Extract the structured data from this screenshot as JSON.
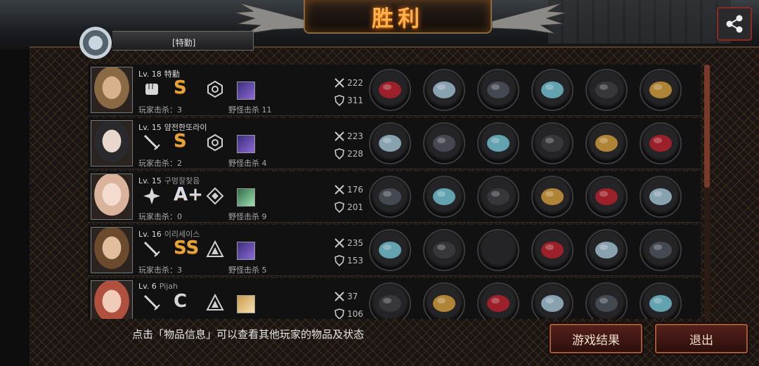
{
  "title": "胜利",
  "badge_text": "[特勤]",
  "hint": "点击「物品信息」可以查看其他玩家的物品及状态",
  "buttons": {
    "result": "游戏结果",
    "exit": "退出"
  },
  "players": [
    {
      "level": "Lv. 18",
      "name": "特勤",
      "grade": "S",
      "player_kills": "玩家击杀：3",
      "monster_kills": "野怪击杀 11",
      "atk": "222",
      "def": "311",
      "items": [
        "red-claw-gauntlet-icon",
        "white-mask-icon",
        "black-armor-icon",
        "crystal-bracer-icon",
        "dark-boots-icon",
        "gold-earring-icon"
      ]
    },
    {
      "level": "Lv. 15",
      "name": "얌전한또라이",
      "grade": "S",
      "player_kills": "玩家击杀：2",
      "monster_kills": "野怪击杀 4",
      "atk": "223",
      "def": "228",
      "items": [
        "red-blade-icon",
        "white-mask-icon",
        "plate-armor-icon",
        "spiked-gauntlet-icon",
        "dark-boots-icon",
        "galaxy-orb-icon"
      ]
    },
    {
      "level": "Lv. 15",
      "name": "구멍잘찾음",
      "grade": "A+",
      "player_kills": "玩家击杀：0",
      "monster_kills": "野怪击杀 9",
      "atk": "176",
      "def": "201",
      "items": [
        "bladed-spear-icon",
        "silver-headband-icon",
        "red-coat-icon",
        "steel-disc-icon",
        "dark-boots-icon",
        "pink-pearl-icon"
      ]
    },
    {
      "level": "Lv. 16",
      "name": "이리세이스",
      "grade": "SS",
      "player_kills": "玩家击杀：3",
      "monster_kills": "野怪击杀 5",
      "atk": "235",
      "def": "153",
      "items": [
        "blue-rapier-icon",
        "gold-helmet-icon",
        "empty-slot-icon",
        "sapphire-bracelet-icon",
        "blue-sneakers-icon",
        "cardboard-box-icon"
      ]
    },
    {
      "level": "Lv. 6",
      "name": "Pijah",
      "grade": "C",
      "player_kills": "",
      "monster_kills": "",
      "atk": "37",
      "def": "106",
      "items": [
        "knife-icon",
        "venetian-mask-icon",
        "chainmail-icon",
        "wristwatch-icon",
        "combat-boots-icon",
        "green-stick-icon"
      ]
    }
  ],
  "colors": {
    "title": "#ffb24a",
    "grade": "#e8a33a",
    "button_border": "#a05a36"
  }
}
